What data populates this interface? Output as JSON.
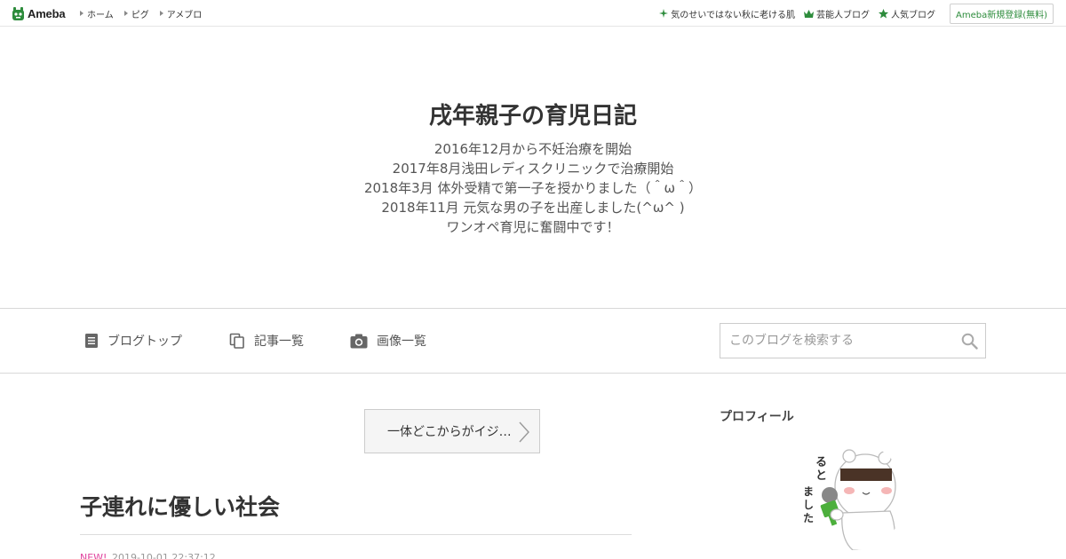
{
  "topbar": {
    "logo": "Ameba",
    "nav": [
      "ホーム",
      "ピグ",
      "アメブロ"
    ],
    "links": [
      {
        "label": "気のせいではない秋に老ける肌",
        "icon": "sparkle-icon"
      },
      {
        "label": "芸能人ブログ",
        "icon": "crown-icon"
      },
      {
        "label": "人気ブログ",
        "icon": "star-icon"
      }
    ],
    "register": "Ameba新規登録(無料)"
  },
  "blog": {
    "title": "戌年親子の育児日記",
    "description": [
      "2016年12月から不妊治療を開始",
      "2017年8月浅田レディスクリニックで治療開始",
      "2018年3月 体外受精で第一子を授かりました（＾ω＾）",
      "2018年11月 元気な男の子を出産しました(^ω^ )",
      "ワンオペ育児に奮闘中です！"
    ]
  },
  "nav": {
    "items": [
      {
        "label": "ブログトップ",
        "icon": "document-icon"
      },
      {
        "label": "記事一覧",
        "icon": "copy-icon"
      },
      {
        "label": "画像一覧",
        "icon": "camera-icon"
      }
    ],
    "search_placeholder": "このブログを検索する"
  },
  "content": {
    "prev_article": "一体どこからがイジ…",
    "article_title": "子連れに優しい社会",
    "new_badge": "NEW!",
    "date": "2019-10-01 22:37:12"
  },
  "sidebar": {
    "profile_heading": "プロフィール"
  },
  "colors": {
    "accent_green": "#2d8c3c",
    "new_pink": "#e0419d"
  }
}
